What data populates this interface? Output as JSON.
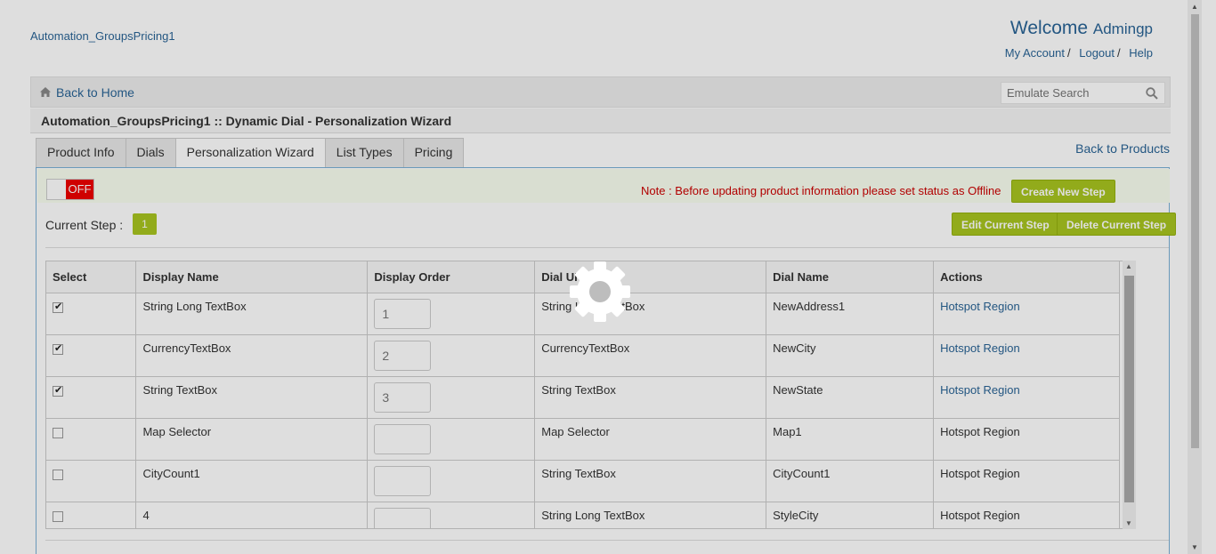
{
  "header": {
    "store_name": "Automation_GroupsPricing1",
    "welcome": "Welcome",
    "user": "Admingp",
    "links": [
      "My Account",
      "Logout",
      "Help"
    ],
    "sep": "/"
  },
  "navbar": {
    "back_home": "Back to Home",
    "search_placeholder": "Emulate Search"
  },
  "page_title": "Automation_GroupsPricing1 :: Dynamic Dial - Personalization Wizard",
  "tabs": [
    {
      "label": "Product Info"
    },
    {
      "label": "Dials"
    },
    {
      "label": "Personalization Wizard"
    },
    {
      "label": "List Types"
    },
    {
      "label": "Pricing"
    }
  ],
  "active_tab": "Personalization Wizard",
  "back_products": "Back to Products",
  "status": {
    "toggle_label": "OFF",
    "note": "Note : Before updating product information please set status as Offline",
    "create_button": "Create New Step"
  },
  "step": {
    "label": "Current Step :",
    "number": "1",
    "edit_button": "Edit Current Step",
    "delete_button": "Delete Current Step"
  },
  "table": {
    "headers": [
      "Select",
      "Display Name",
      "Display Order",
      "Dial UI",
      "Dial Name",
      "Actions"
    ],
    "rows": [
      {
        "checked": true,
        "display_name": "String Long TextBox",
        "order": "1",
        "dial_ui": "String Long TextBox",
        "dial_name": "NewAddress1",
        "action": "Hotspot Region",
        "action_link": true
      },
      {
        "checked": true,
        "display_name": "CurrencyTextBox",
        "order": "2",
        "dial_ui": "CurrencyTextBox",
        "dial_name": "NewCity",
        "action": "Hotspot Region",
        "action_link": true
      },
      {
        "checked": true,
        "display_name": "String TextBox",
        "order": "3",
        "dial_ui": "String TextBox",
        "dial_name": "NewState",
        "action": "Hotspot Region",
        "action_link": true
      },
      {
        "checked": false,
        "display_name": "Map Selector",
        "order": "",
        "dial_ui": "Map Selector",
        "dial_name": "Map1",
        "action": "Hotspot Region",
        "action_link": false
      },
      {
        "checked": false,
        "display_name": "CityCount1",
        "order": "",
        "dial_ui": "String TextBox",
        "dial_name": "CityCount1",
        "action": "Hotspot Region",
        "action_link": false
      },
      {
        "checked": false,
        "display_name": "4",
        "order": "",
        "dial_ui": "String Long TextBox",
        "dial_name": "StyleCity",
        "action": "Hotspot Region",
        "action_link": false
      }
    ]
  },
  "colors": {
    "link": "#2a6496",
    "accent_green": "#a8c520",
    "toggle_off": "#ee0000",
    "note_red": "#cc0000"
  },
  "icons": {
    "home": "home-icon",
    "search": "search-icon",
    "loading": "gear-icon"
  }
}
